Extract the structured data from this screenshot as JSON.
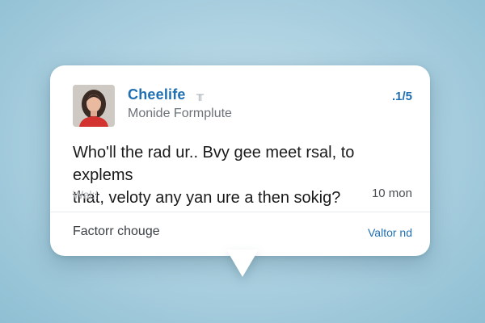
{
  "card": {
    "user_name": "Cheelife",
    "name_badge": "╥",
    "handle": "Monide Formplute",
    "top_right": ".1/5",
    "message_line1": "Who'll the rad ur.. Bvy gee meet rsal, to explems",
    "message_line2": "that, veloty any yan ure a then sokig?",
    "meta_left": "Wal:!",
    "meta_right": "10 mon",
    "footer_left": "Factorr chouge",
    "footer_right": "Valtor nd"
  },
  "icons": {
    "avatar": "user-avatar-photo",
    "badge": "badge-icon"
  },
  "colors": {
    "accent": "#1f6fb2",
    "background": "#a9cfdf",
    "card": "#ffffff"
  }
}
